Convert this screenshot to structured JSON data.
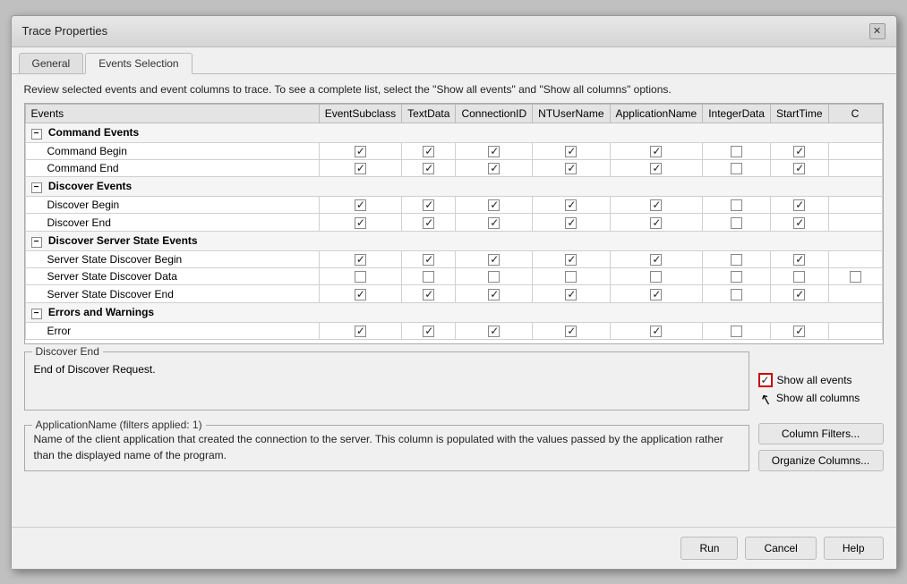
{
  "dialog": {
    "title": "Trace Properties",
    "close_label": "✕"
  },
  "tabs": [
    {
      "label": "General",
      "active": false
    },
    {
      "label": "Events Selection",
      "active": true
    }
  ],
  "instructions": "Review selected events and event columns to trace. To see a complete list, select the \"Show all events\" and \"Show all columns\" options.",
  "columns": [
    "Events",
    "EventSubclass",
    "TextData",
    "ConnectionID",
    "NTUserName",
    "ApplicationName",
    "IntegerData",
    "StartTime",
    "C"
  ],
  "groups": [
    {
      "name": "Command Events",
      "collapsed": true,
      "rows": [
        {
          "name": "Command Begin",
          "checks": [
            true,
            true,
            true,
            true,
            true,
            false,
            true
          ]
        },
        {
          "name": "Command End",
          "checks": [
            true,
            true,
            true,
            true,
            true,
            false,
            true
          ]
        }
      ]
    },
    {
      "name": "Discover Events",
      "collapsed": true,
      "rows": [
        {
          "name": "Discover Begin",
          "checks": [
            true,
            true,
            true,
            true,
            true,
            false,
            true
          ]
        },
        {
          "name": "Discover End",
          "checks": [
            true,
            true,
            true,
            true,
            true,
            false,
            true
          ]
        }
      ]
    },
    {
      "name": "Discover Server State Events",
      "collapsed": true,
      "rows": [
        {
          "name": "Server State Discover Begin",
          "checks": [
            true,
            true,
            true,
            true,
            true,
            false,
            true
          ]
        },
        {
          "name": "Server State Discover Data",
          "checks": [
            false,
            false,
            false,
            false,
            false,
            false,
            false
          ]
        },
        {
          "name": "Server State Discover End",
          "checks": [
            true,
            true,
            true,
            true,
            true,
            false,
            true
          ]
        }
      ]
    },
    {
      "name": "Errors and Warnings",
      "collapsed": true,
      "rows": [
        {
          "name": "Error",
          "checks": [
            true,
            true,
            true,
            true,
            true,
            false,
            true
          ]
        }
      ]
    }
  ],
  "discover_end": {
    "label": "Discover End",
    "text": "End of Discover Request."
  },
  "show_options": {
    "show_all_events_label": "Show all events",
    "show_all_events_checked": true,
    "show_columns_label": "Show all columns"
  },
  "filter_section": {
    "label": "ApplicationName (filters applied: 1)",
    "text": "Name of the client application that created the connection to the server. This column is populated with the values passed by the application rather than the displayed name of the program."
  },
  "buttons": {
    "column_filters": "Column Filters...",
    "organize_columns": "Organize Columns..."
  },
  "footer": {
    "run": "Run",
    "cancel": "Cancel",
    "help": "Help"
  }
}
